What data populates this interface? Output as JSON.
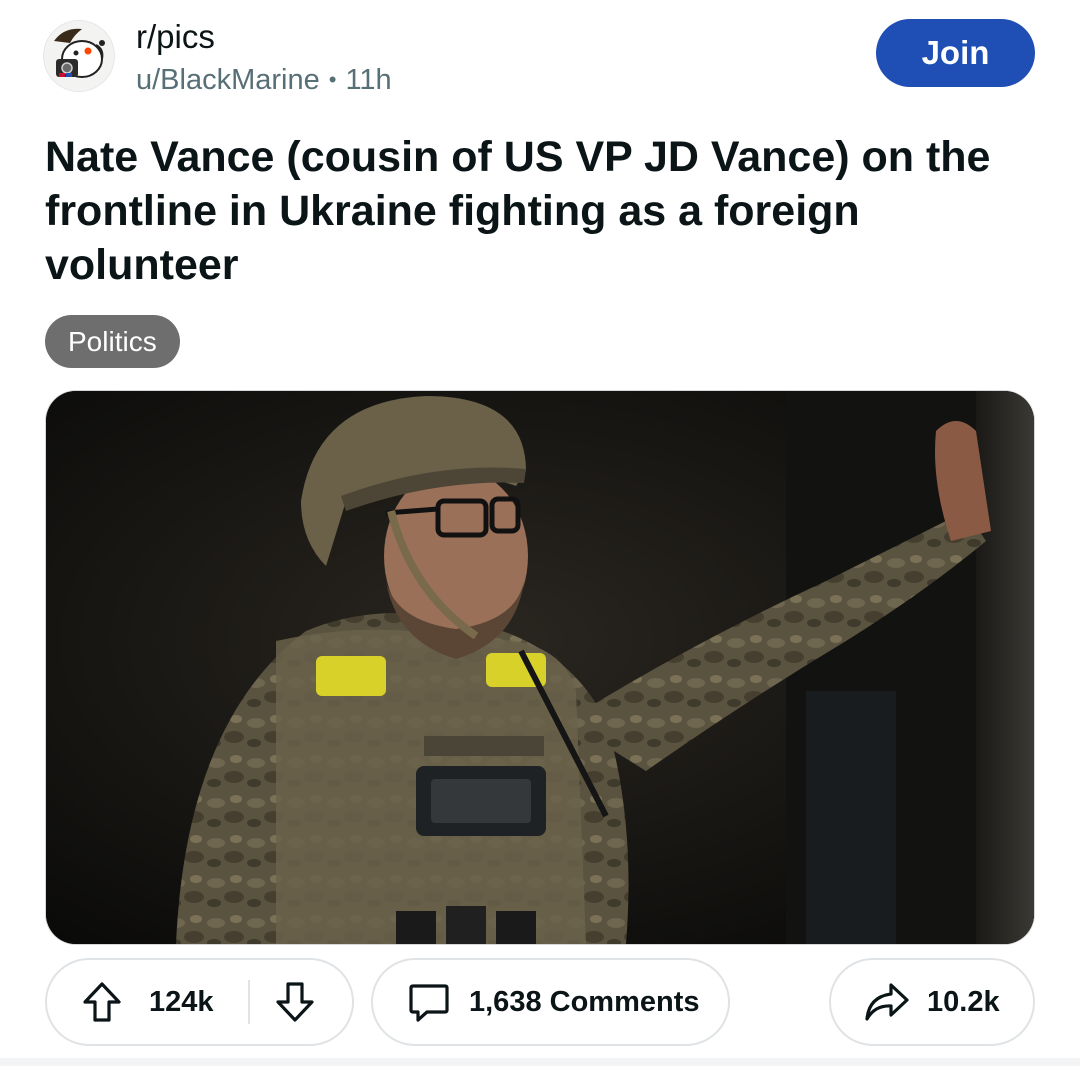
{
  "header": {
    "subreddit": "r/pics",
    "author": "u/BlackMarine",
    "separator": "•",
    "age": "11h",
    "join_label": "Join",
    "join_color": "#1f4fb4",
    "avatar_icon": "subreddit-avatar-icon"
  },
  "post": {
    "title": "Nate Vance (cousin of US VP JD Vance) on the frontline in Ukraine fighting as a foreign volunteer",
    "flair": "Politics",
    "image_subject": "soldier-photo"
  },
  "actions": {
    "upvotes": "124k",
    "upvote_icon": "upvote-arrow-icon",
    "downvote_icon": "downvote-arrow-icon",
    "comments_label": "1,638 Comments",
    "comment_icon": "comment-bubble-icon",
    "shares": "10.2k",
    "share_icon": "share-arrow-icon"
  }
}
